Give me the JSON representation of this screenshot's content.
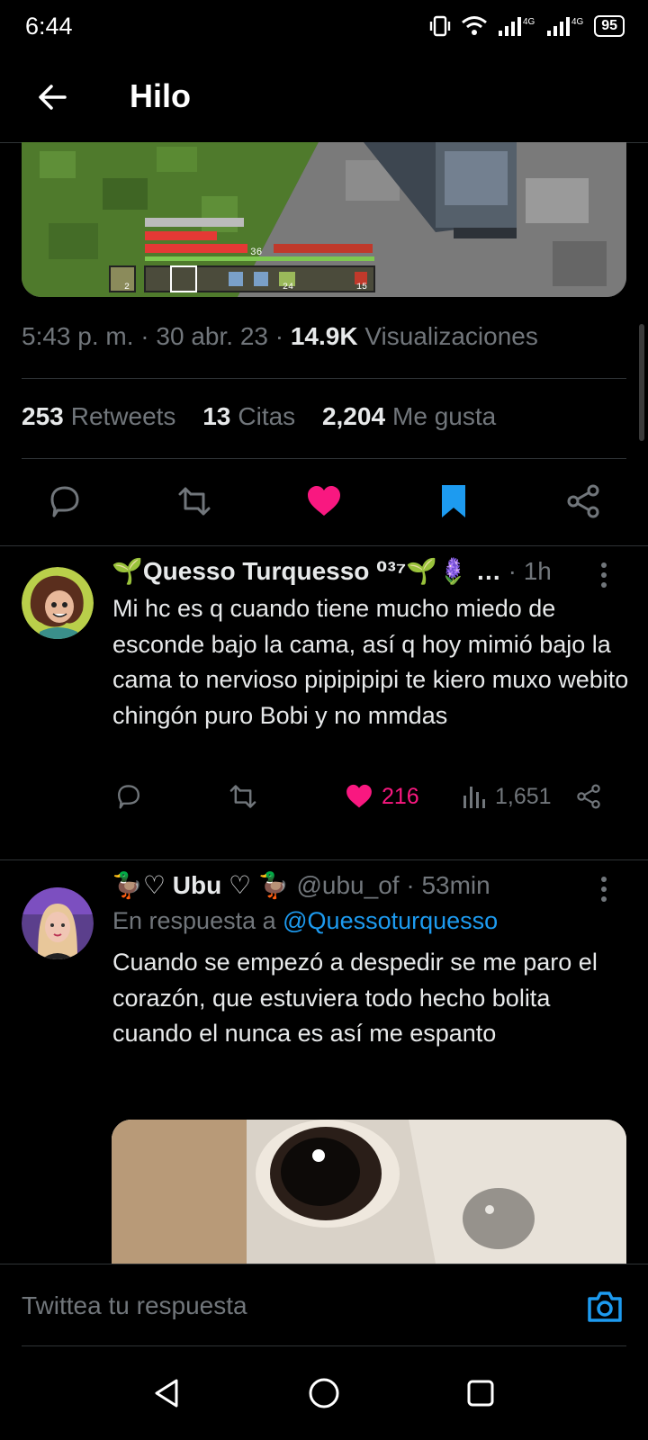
{
  "status_bar": {
    "time": "6:44",
    "network1": "4G",
    "network2": "4G",
    "battery": "95"
  },
  "header": {
    "title": "Hilo"
  },
  "main_tweet": {
    "time": "5:43 p. m.",
    "date": "30 abr. 23",
    "views_count": "14.9K",
    "views_label": "Visualizaciones",
    "retweets_count": "253",
    "retweets_label": "Retweets",
    "quotes_count": "13",
    "quotes_label": "Citas",
    "likes_count": "2,204",
    "likes_label": "Me gusta",
    "game_hud": {
      "hotbar_count1": "2",
      "hotbar_count2": "24",
      "hotbar_count3": "15",
      "level": "36"
    }
  },
  "replies": [
    {
      "name": "🌱Quesso Turquesso ⁰³⁷🌱🪻",
      "name_suffix": "…",
      "time": "· 1h",
      "text": "Mi hc es q cuando tiene mucho miedo de esconde bajo la cama, así q hoy mimió bajo la cama to nervioso pipipipipi te kiero muxo webito chingón puro Bobi y no mmdas",
      "likes": "216",
      "views": "1,651"
    },
    {
      "name": "🦆♡ Ubu ♡ 🦆",
      "handle": "@ubu_of",
      "time": "· 53min",
      "reply_prefix": "En respuesta a",
      "reply_to": "@Quessoturquesso",
      "text": "Cuando se empezó a despedir se me paro el corazón, que estuviera todo hecho bolita cuando el nunca es así me espanto"
    }
  ],
  "compose": {
    "placeholder": "Twittea tu respuesta"
  },
  "colors": {
    "accent": "#1d9bf0",
    "like": "#f91880",
    "muted": "#71767b",
    "text": "#e7e9ea"
  }
}
